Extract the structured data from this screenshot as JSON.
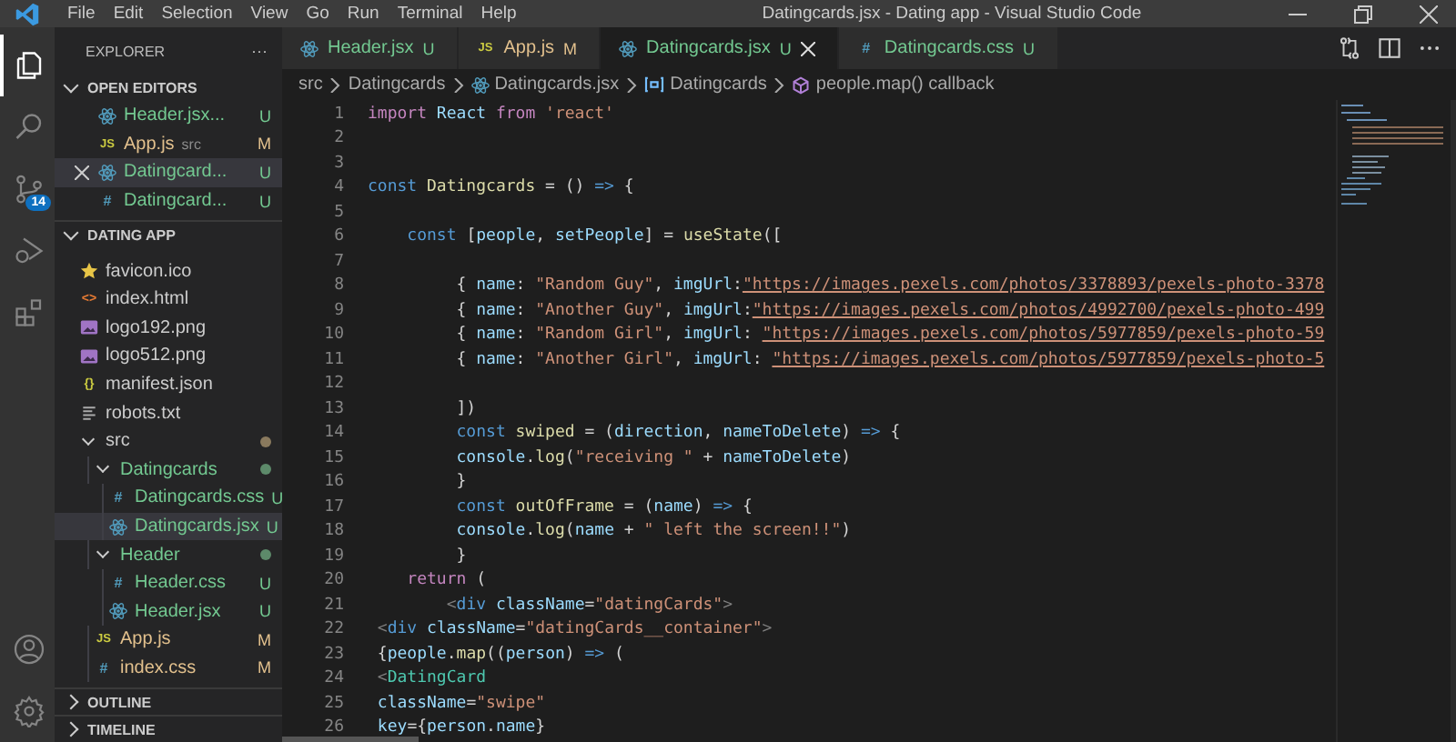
{
  "window": {
    "title": "Datingcards.jsx - Dating app - Visual Studio Code",
    "menu": [
      "File",
      "Edit",
      "Selection",
      "View",
      "Go",
      "Run",
      "Terminal",
      "Help"
    ]
  },
  "activity_bar": [
    {
      "kind": "files",
      "selected": true
    },
    {
      "kind": "search",
      "selected": false
    },
    {
      "kind": "source-control",
      "selected": false,
      "badge": "14"
    },
    {
      "kind": "run",
      "selected": false
    },
    {
      "kind": "extensions",
      "selected": false
    }
  ],
  "activity_bar_bottom": [
    {
      "kind": "account"
    },
    {
      "kind": "settings"
    }
  ],
  "sidebar": {
    "title": "EXPLORER",
    "more": "···",
    "open_editors": {
      "title": "OPEN EDITORS",
      "expanded": true,
      "items": [
        {
          "name": "Header.jsx...",
          "kind": "react",
          "color": "#73c991",
          "status": "U",
          "selected": false,
          "close": false
        },
        {
          "name": "App.js",
          "kind": "js",
          "glyph": "JS",
          "folder": "src",
          "color": "#e2c08d",
          "status": "M",
          "selected": false,
          "close": false
        },
        {
          "name": "Datingcard...",
          "kind": "react",
          "color": "#73c991",
          "status": "U",
          "selected": true,
          "close": true
        },
        {
          "name": "Datingcard...",
          "kind": "css",
          "glyph": "#",
          "color": "#73c991",
          "status": "U",
          "selected": false,
          "close": false
        }
      ]
    },
    "project": {
      "title": "DATING APP",
      "expanded": true,
      "items": [
        {
          "name": "favicon.ico",
          "kind": "star",
          "selected": false
        },
        {
          "name": "index.html",
          "kind": "html",
          "glyph": "<>",
          "selected": false
        },
        {
          "name": "logo192.png",
          "kind": "image",
          "selected": false
        },
        {
          "name": "logo512.png",
          "kind": "image",
          "selected": false
        },
        {
          "name": "manifest.json",
          "kind": "json",
          "glyph": "{}",
          "selected": false
        },
        {
          "name": "robots.txt",
          "kind": "text",
          "selected": false
        },
        {
          "name": "src",
          "kind": "folder",
          "expanded": true,
          "marker": {
            "color": "#8a7a5e"
          },
          "selected": false,
          "children": [
            {
              "name": "Datingcards",
              "kind": "folder",
              "expanded": true,
              "color": "#73c991",
              "marker": {
                "color": "#5d8a6a"
              },
              "selected": false,
              "children": [
                {
                  "name": "Datingcards.css",
                  "kind": "css",
                  "glyph": "#",
                  "color": "#73c991",
                  "status": "U",
                  "selected": false
                },
                {
                  "name": "Datingcards.jsx",
                  "kind": "react",
                  "color": "#73c991",
                  "status": "U",
                  "selected": true
                }
              ]
            },
            {
              "name": "Header",
              "kind": "folder",
              "expanded": true,
              "color": "#73c991",
              "marker": {
                "color": "#5d8a6a"
              },
              "selected": false,
              "children": [
                {
                  "name": "Header.css",
                  "kind": "css",
                  "glyph": "#",
                  "color": "#73c991",
                  "status": "U",
                  "selected": false
                },
                {
                  "name": "Header.jsx",
                  "kind": "react",
                  "color": "#73c991",
                  "status": "U",
                  "selected": false
                }
              ]
            },
            {
              "name": "App.js",
              "kind": "js",
              "glyph": "JS",
              "color": "#e2c08d",
              "status": "M",
              "selected": false
            },
            {
              "name": "index.css",
              "kind": "css",
              "glyph": "#",
              "color": "#e2c08d",
              "status": "M",
              "selected": false
            }
          ]
        }
      ]
    },
    "collapsed_sections": [
      "OUTLINE",
      "TIMELINE"
    ]
  },
  "tabs": [
    {
      "label": "Header.jsx",
      "kind": "react",
      "status": "U",
      "color": "#73c991",
      "selected": false
    },
    {
      "label": "App.js",
      "kind": "js",
      "glyph": "JS",
      "status": "M",
      "color": "#e2c08d",
      "selected": false
    },
    {
      "label": "Datingcards.jsx",
      "kind": "react",
      "status": "U",
      "color": "#73c991",
      "selected": true
    },
    {
      "label": "Datingcards.css",
      "kind": "css",
      "glyph": "#",
      "status": "U",
      "color": "#73c991",
      "selected": false
    }
  ],
  "breadcrumbs": [
    {
      "label": "src",
      "kind": "folder"
    },
    {
      "label": "Datingcards",
      "kind": "folder"
    },
    {
      "label": "Datingcards.jsx",
      "kind": "react"
    },
    {
      "label": "Datingcards",
      "kind": "variable"
    },
    {
      "label": "people.map() callback",
      "kind": "method"
    }
  ],
  "code": [
    {
      "number": "1",
      "tokens": [
        {
          "kind": "control",
          "text": "import"
        },
        {
          "kind": "variable",
          "text": " React"
        },
        {
          "kind": "control",
          "text": " from"
        },
        {
          "kind": "string",
          "text": " 'react'"
        }
      ]
    },
    {
      "number": "2"
    },
    {
      "number": "3"
    },
    {
      "number": "4",
      "tokens": [
        {
          "kind": "keyword",
          "text": "const"
        },
        {
          "kind": "function",
          "text": " Datingcards"
        },
        {
          "kind": "plain",
          "text": " = () "
        },
        {
          "kind": "keyword",
          "text": "=>"
        },
        {
          "kind": "plain",
          "text": " {"
        }
      ]
    },
    {
      "number": "5"
    },
    {
      "number": "6",
      "tokens": [
        {
          "kind": "keyword",
          "text": "    const"
        },
        {
          "kind": "plain",
          "text": " ["
        },
        {
          "kind": "variable",
          "text": "people"
        },
        {
          "kind": "plain",
          "text": ", "
        },
        {
          "kind": "variable",
          "text": "setPeople"
        },
        {
          "kind": "plain",
          "text": "] = "
        },
        {
          "kind": "function",
          "text": "useState"
        },
        {
          "kind": "plain",
          "text": "(["
        }
      ]
    },
    {
      "number": "7"
    },
    {
      "number": "8",
      "tokens": [
        {
          "kind": "plain",
          "text": "         { "
        },
        {
          "kind": "variable",
          "text": "name"
        },
        {
          "kind": "plain",
          "text": ": "
        },
        {
          "kind": "string",
          "text": "\"Random Guy\""
        },
        {
          "kind": "plain",
          "text": ", "
        },
        {
          "kind": "variable",
          "text": "imgUrl"
        },
        {
          "kind": "plain",
          "text": ":"
        },
        {
          "kind": "link",
          "text": "\"https://images.pexels.com/photos/3378893/pexels-photo-3378"
        }
      ]
    },
    {
      "number": "9",
      "tokens": [
        {
          "kind": "plain",
          "text": "         { "
        },
        {
          "kind": "variable",
          "text": "name"
        },
        {
          "kind": "plain",
          "text": ": "
        },
        {
          "kind": "string",
          "text": "\"Another Guy\""
        },
        {
          "kind": "plain",
          "text": ", "
        },
        {
          "kind": "variable",
          "text": "imgUrl"
        },
        {
          "kind": "plain",
          "text": ":"
        },
        {
          "kind": "link",
          "text": "\"https://images.pexels.com/photos/4992700/pexels-photo-499"
        }
      ]
    },
    {
      "number": "10",
      "tokens": [
        {
          "kind": "plain",
          "text": "         { "
        },
        {
          "kind": "variable",
          "text": "name"
        },
        {
          "kind": "plain",
          "text": ": "
        },
        {
          "kind": "string",
          "text": "\"Random Girl\""
        },
        {
          "kind": "plain",
          "text": ", "
        },
        {
          "kind": "variable",
          "text": "imgUrl"
        },
        {
          "kind": "plain",
          "text": ": "
        },
        {
          "kind": "link",
          "text": "\"https://images.pexels.com/photos/5977859/pexels-photo-59"
        }
      ]
    },
    {
      "number": "11",
      "tokens": [
        {
          "kind": "plain",
          "text": "         { "
        },
        {
          "kind": "variable",
          "text": "name"
        },
        {
          "kind": "plain",
          "text": ": "
        },
        {
          "kind": "string",
          "text": "\"Another Girl\""
        },
        {
          "kind": "plain",
          "text": ", "
        },
        {
          "kind": "variable",
          "text": "imgUrl"
        },
        {
          "kind": "plain",
          "text": ": "
        },
        {
          "kind": "link",
          "text": "\"https://images.pexels.com/photos/5977859/pexels-photo-5"
        }
      ]
    },
    {
      "number": "12"
    },
    {
      "number": "13",
      "tokens": [
        {
          "kind": "plain",
          "text": "         ])"
        }
      ]
    },
    {
      "number": "14",
      "tokens": [
        {
          "kind": "keyword",
          "text": "         const"
        },
        {
          "kind": "function",
          "text": " swiped"
        },
        {
          "kind": "plain",
          "text": " = ("
        },
        {
          "kind": "variable",
          "text": "direction"
        },
        {
          "kind": "plain",
          "text": ", "
        },
        {
          "kind": "variable",
          "text": "nameToDelete"
        },
        {
          "kind": "plain",
          "text": ") "
        },
        {
          "kind": "keyword",
          "text": "=>"
        },
        {
          "kind": "plain",
          "text": " {"
        }
      ]
    },
    {
      "number": "15",
      "tokens": [
        {
          "kind": "variable",
          "text": "         console"
        },
        {
          "kind": "plain",
          "text": "."
        },
        {
          "kind": "function",
          "text": "log"
        },
        {
          "kind": "plain",
          "text": "("
        },
        {
          "kind": "string",
          "text": "\"receiving \""
        },
        {
          "kind": "plain",
          "text": " + "
        },
        {
          "kind": "variable",
          "text": "nameToDelete"
        },
        {
          "kind": "plain",
          "text": ")"
        }
      ]
    },
    {
      "number": "16",
      "tokens": [
        {
          "kind": "plain",
          "text": "         }"
        }
      ]
    },
    {
      "number": "17",
      "tokens": [
        {
          "kind": "keyword",
          "text": "         const"
        },
        {
          "kind": "function",
          "text": " outOfFrame"
        },
        {
          "kind": "plain",
          "text": " = ("
        },
        {
          "kind": "variable",
          "text": "name"
        },
        {
          "kind": "plain",
          "text": ") "
        },
        {
          "kind": "keyword",
          "text": "=>"
        },
        {
          "kind": "plain",
          "text": " {"
        }
      ]
    },
    {
      "number": "18",
      "tokens": [
        {
          "kind": "variable",
          "text": "         console"
        },
        {
          "kind": "plain",
          "text": "."
        },
        {
          "kind": "function",
          "text": "log"
        },
        {
          "kind": "plain",
          "text": "("
        },
        {
          "kind": "variable",
          "text": "name"
        },
        {
          "kind": "plain",
          "text": " + "
        },
        {
          "kind": "string",
          "text": "\" left the screen!!\""
        },
        {
          "kind": "plain",
          "text": ")"
        }
      ]
    },
    {
      "number": "19",
      "tokens": [
        {
          "kind": "plain",
          "text": "         }"
        }
      ]
    },
    {
      "number": "20",
      "tokens": [
        {
          "kind": "control",
          "text": "    return"
        },
        {
          "kind": "plain",
          "text": " ("
        }
      ]
    },
    {
      "number": "21",
      "tokens": [
        {
          "kind": "tag",
          "text": "        <"
        },
        {
          "kind": "keyword",
          "text": "div"
        },
        {
          "kind": "variable",
          "text": " className"
        },
        {
          "kind": "plain",
          "text": "="
        },
        {
          "kind": "string",
          "text": "\"datingCards\""
        },
        {
          "kind": "tag",
          "text": ">"
        }
      ]
    },
    {
      "number": "22",
      "tokens": [
        {
          "kind": "tag",
          "text": " <"
        },
        {
          "kind": "keyword",
          "text": "div"
        },
        {
          "kind": "variable",
          "text": " className"
        },
        {
          "kind": "plain",
          "text": "="
        },
        {
          "kind": "string",
          "text": "\"datingCards__container\""
        },
        {
          "kind": "tag",
          "text": ">"
        }
      ]
    },
    {
      "number": "23",
      "tokens": [
        {
          "kind": "plain",
          "text": " {"
        },
        {
          "kind": "variable",
          "text": "people"
        },
        {
          "kind": "plain",
          "text": "."
        },
        {
          "kind": "function",
          "text": "map"
        },
        {
          "kind": "plain",
          "text": "(("
        },
        {
          "kind": "variable",
          "text": "person"
        },
        {
          "kind": "plain",
          "text": ") "
        },
        {
          "kind": "keyword",
          "text": "=>"
        },
        {
          "kind": "plain",
          "text": " ("
        }
      ]
    },
    {
      "number": "24",
      "tokens": [
        {
          "kind": "tag",
          "text": " <"
        },
        {
          "kind": "component",
          "text": "DatingCard"
        }
      ]
    },
    {
      "number": "25",
      "tokens": [
        {
          "kind": "variable",
          "text": " className"
        },
        {
          "kind": "plain",
          "text": "="
        },
        {
          "kind": "string",
          "text": "\"swipe\""
        }
      ]
    },
    {
      "number": "26",
      "tokens": [
        {
          "kind": "variable",
          "text": " key"
        },
        {
          "kind": "plain",
          "text": "={"
        },
        {
          "kind": "variable",
          "text": "person"
        },
        {
          "kind": "plain",
          "text": "."
        },
        {
          "kind": "variable",
          "text": "name"
        },
        {
          "kind": "plain",
          "text": "}"
        }
      ]
    }
  ]
}
